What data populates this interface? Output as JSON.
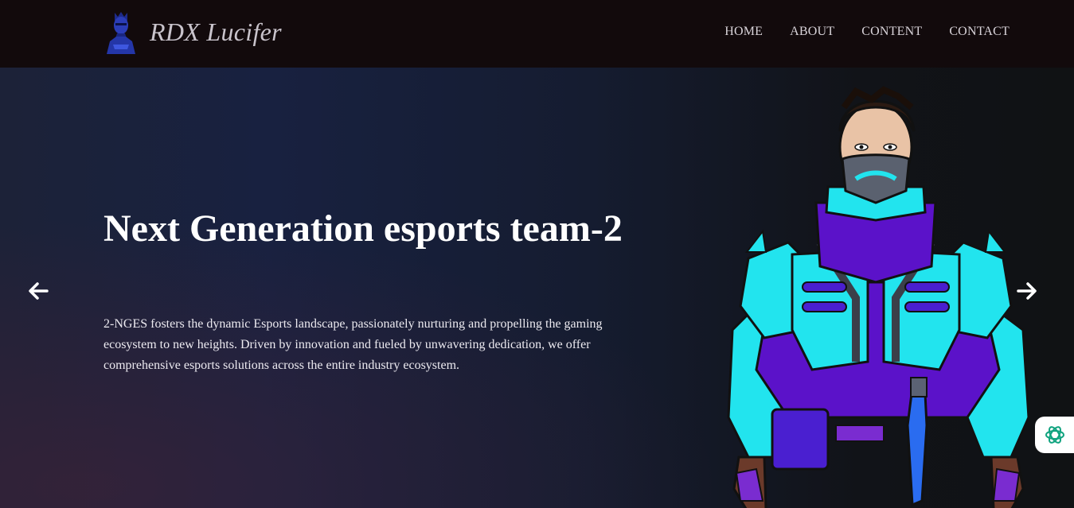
{
  "header": {
    "brand_name": "RDX Lucifer",
    "nav": [
      {
        "label": "HOME"
      },
      {
        "label": "ABOUT"
      },
      {
        "label": "CONTENT"
      },
      {
        "label": "CONTACT"
      }
    ]
  },
  "hero": {
    "headline": "Next Generation esports team-2",
    "description": "2-NGES fosters the dynamic Esports landscape, passionately nurturing and propelling the gaming ecosystem to new heights. Driven by innovation and fueled by unwavering dedication, we offer comprehensive esports solutions across the entire industry ecosystem."
  },
  "icons": {
    "logo": "avatar-logo-icon",
    "prev": "arrow-left-icon",
    "next": "arrow-right-icon",
    "badge": "openai-icon"
  },
  "colors": {
    "header_bg": "#120a0c",
    "text": "#ffffff",
    "cyan": "#22e4ee",
    "purple": "#5b12c9",
    "badge_accent": "#10a37f"
  }
}
